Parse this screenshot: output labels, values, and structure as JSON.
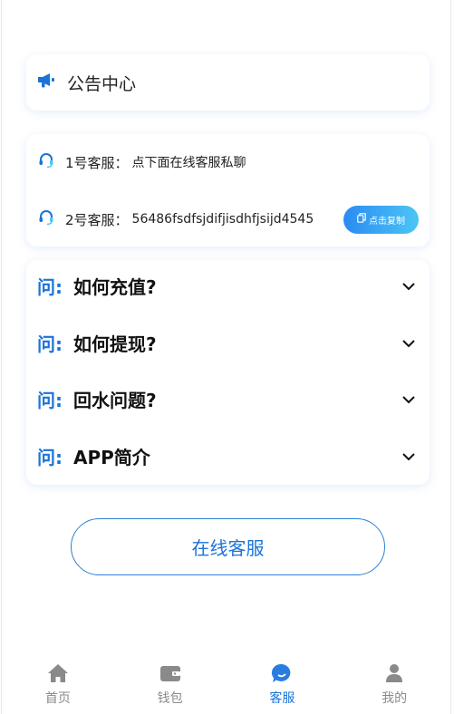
{
  "notice": {
    "title": "公告中心"
  },
  "service": {
    "rows": [
      {
        "label": "1号客服：",
        "value": "点下面在线客服私聊"
      },
      {
        "label": "2号客服：",
        "value": "56486fsdfsjdifjisdhfjsijd4545",
        "copy_label": "点击复制"
      }
    ]
  },
  "faq": {
    "prefix": "问:",
    "items": [
      {
        "question": "如何充值?"
      },
      {
        "question": "如何提现?"
      },
      {
        "question": "回水问题?"
      },
      {
        "question": "APP简介"
      }
    ]
  },
  "online_button": {
    "label": "在线客服"
  },
  "tabbar": {
    "active_index": 2,
    "items": [
      {
        "label": "首页",
        "icon": "home-icon"
      },
      {
        "label": "钱包",
        "icon": "wallet-icon"
      },
      {
        "label": "客服",
        "icon": "chat-icon"
      },
      {
        "label": "我的",
        "icon": "user-icon"
      }
    ]
  },
  "colors": {
    "accent": "#1a74d8",
    "inactive": "#8a8a8a",
    "gradient_start": "#2a8bf2",
    "gradient_end": "#4cc6f5"
  }
}
